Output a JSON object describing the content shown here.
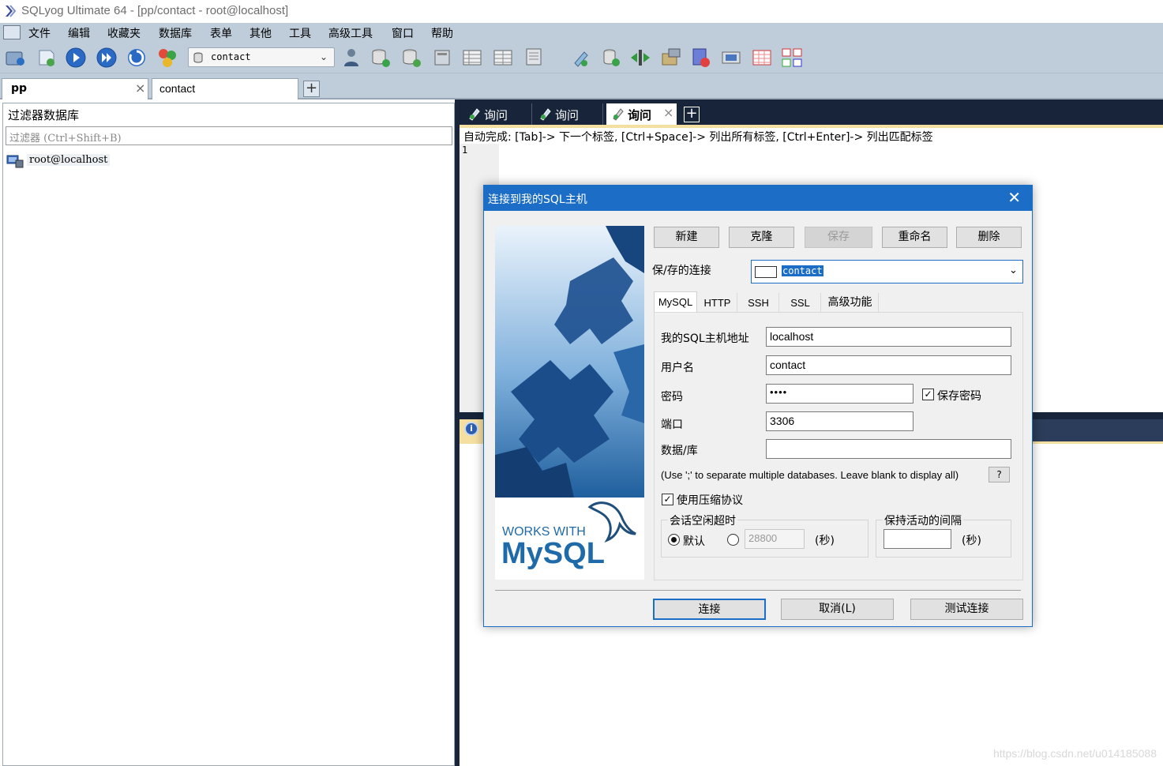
{
  "window": {
    "title": "SQLyog Ultimate 64 - [pp/contact - root@localhost]"
  },
  "menu": [
    "文件",
    "编辑",
    "收藏夹",
    "数据库",
    "表单",
    "其他",
    "工具",
    "高级工具",
    "窗口",
    "帮助"
  ],
  "toolbar": {
    "db_select": "contact"
  },
  "connection_tabs": [
    {
      "label": "pp",
      "active": true
    },
    {
      "label": "contact",
      "active": false
    }
  ],
  "left_panel": {
    "header": "过滤器数据库",
    "filter_placeholder": "过滤器 (Ctrl+Shift+B)",
    "tree_root": "root@localhost"
  },
  "query_tabs": [
    {
      "label": "询问",
      "active": false
    },
    {
      "label": "询问",
      "active": false
    },
    {
      "label": "询问",
      "active": true
    }
  ],
  "editor": {
    "autocomplete_hint": "自动完成: [Tab]-> 下一个标签, [Ctrl+Space]-> 列出所有标签, [Ctrl+Enter]-> 列出匹配标签",
    "line_number": "1"
  },
  "dialog": {
    "title": "连接到我的SQL主机",
    "buttons": {
      "new": "新建",
      "clone": "克隆",
      "save": "保存",
      "rename": "重命名",
      "delete": "删除"
    },
    "saved_connections_label": "保/存的连接",
    "saved_connection_value": "contact",
    "tabs": [
      "MySQL",
      "HTTP",
      "SSH",
      "SSL",
      "高级功能"
    ],
    "logo_text_top": "WORKS WITH",
    "logo_text_main": "MySQL",
    "fields": {
      "host_label": "我的SQL主机地址",
      "host_value": "localhost",
      "user_label": "用户名",
      "user_value": "contact",
      "password_label": "密码",
      "password_value": "••••",
      "save_password_label": "保存密码",
      "port_label": "端口",
      "port_value": "3306",
      "database_label": "数据/库",
      "database_value": ""
    },
    "db_hint": "(Use ';' to separate multiple databases. Leave blank to display all)",
    "help_button": "?",
    "compress_label": "使用压缩协议",
    "session_timeout": {
      "title": "会话空闲超时",
      "default_label": "默认",
      "custom_value": "28800",
      "unit": "(秒)"
    },
    "keepalive": {
      "title": "保持活动的间隔",
      "value": "",
      "unit": "(秒)"
    },
    "footer": {
      "connect": "连接",
      "cancel": "取消(L)",
      "test": "测试连接"
    }
  },
  "watermark": "https://blog.csdn.net/u014185088"
}
